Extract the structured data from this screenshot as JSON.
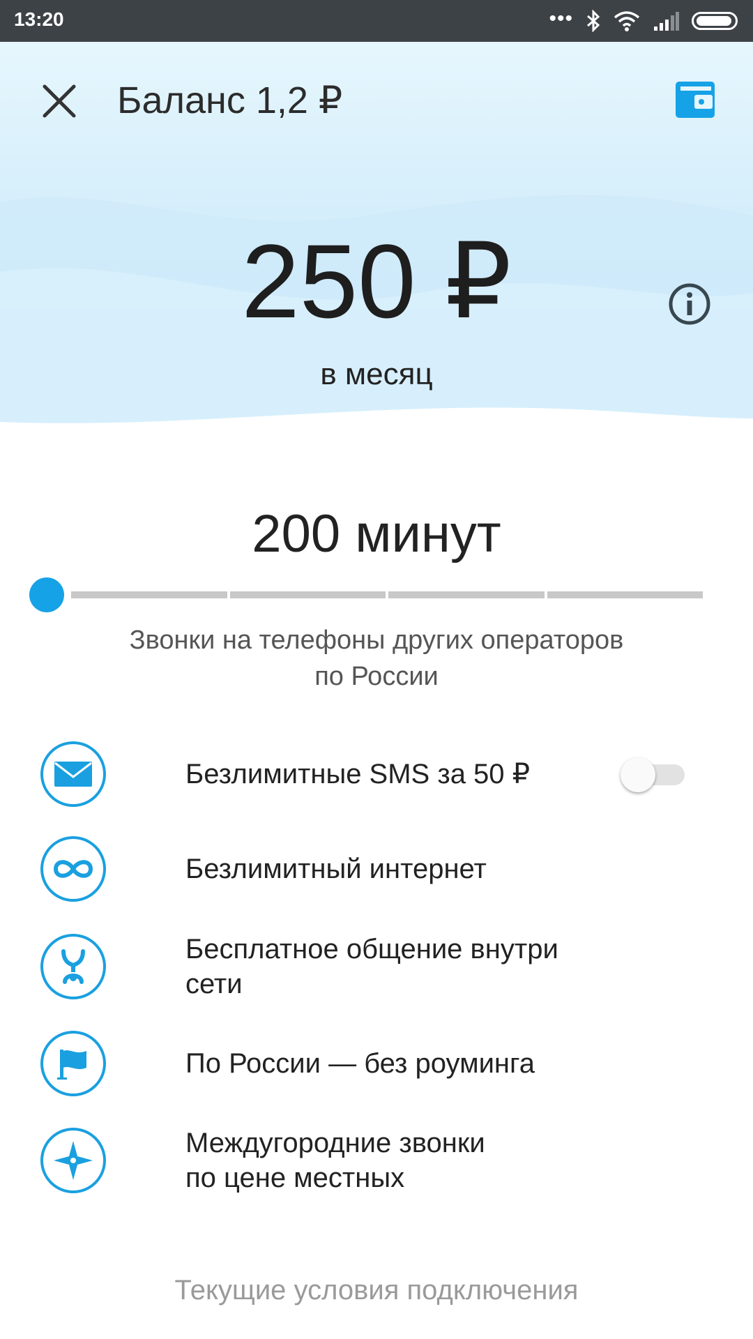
{
  "status_bar": {
    "time": "13:20",
    "dots": "•••",
    "icons": [
      "bluetooth-icon",
      "wifi-icon",
      "signal-icon",
      "battery-icon"
    ]
  },
  "header": {
    "title": "Баланс 1,2 ₽",
    "close_icon": "close-icon",
    "wallet_icon": "wallet-icon"
  },
  "tariff": {
    "price": "250 ₽",
    "period": "в месяц",
    "info_icon": "info-icon"
  },
  "minutes": {
    "value": "200 минут",
    "slider_segments": 5,
    "slider_position": 0,
    "description_line1": "Звонки на телефоны других операторов",
    "description_line2": "по России"
  },
  "features": [
    {
      "label": "Безлимитные SMS за 50 ₽",
      "icon": "envelope-icon",
      "toggle": false
    },
    {
      "label": "Безлимитный интернет",
      "icon": "infinity-icon"
    },
    {
      "label_line1": "Бесплатное общение внутри",
      "label_line2": "сети",
      "icon": "yota-logo-icon"
    },
    {
      "label": "По России — без роуминга",
      "icon": "flag-icon"
    },
    {
      "label_line1": "Междугородние звонки",
      "label_line2": "по цене местных",
      "icon": "compass-icon"
    }
  ],
  "footer": {
    "link": "Текущие условия подключения"
  },
  "colors": {
    "accent": "#16a2e6",
    "status_bar": "#3d4247",
    "hero_bg": "#d4eefb"
  }
}
